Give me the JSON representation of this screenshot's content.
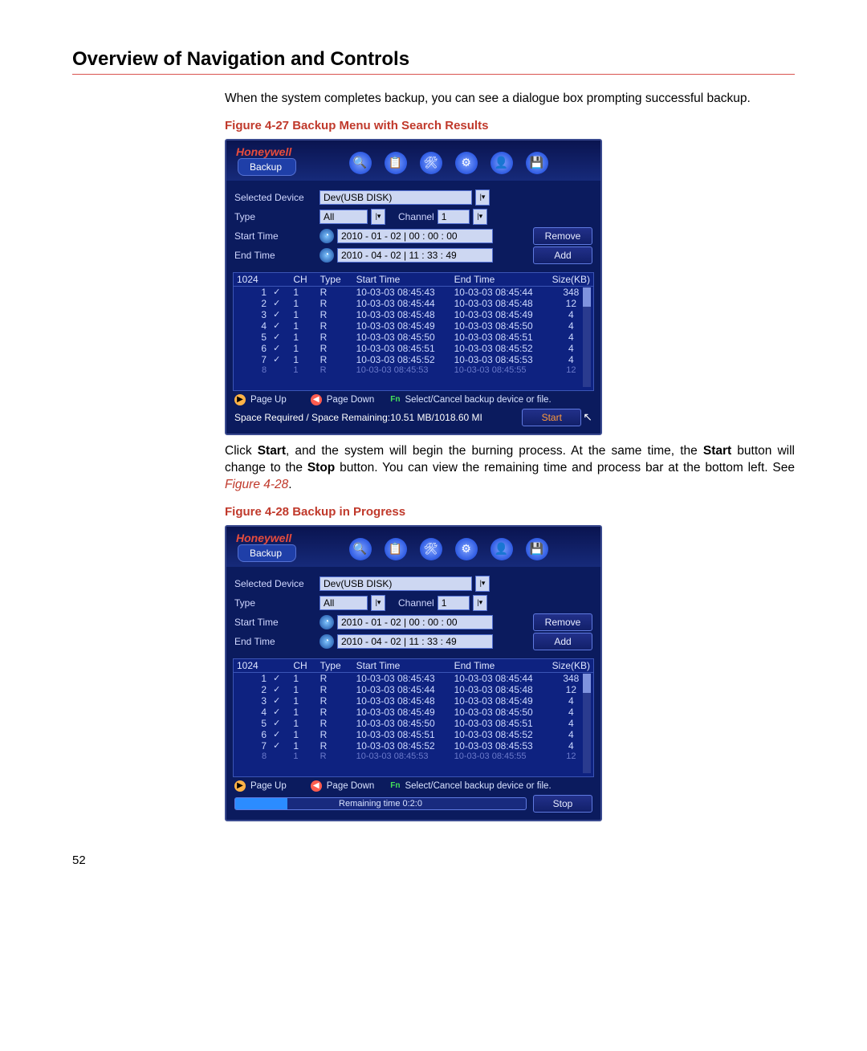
{
  "page": {
    "title": "Overview of Navigation and Controls",
    "intro": "When the system completes backup, you can see a dialogue box prompting successful backup.",
    "fig1_caption": "Figure 4-27 Backup Menu with Search Results",
    "mid_text_1": "Click ",
    "mid_text_start": "Start",
    "mid_text_2": ", and the system will begin the burning process. At the same time, the ",
    "mid_text_start2": "Start",
    "mid_text_3": " button will change to the ",
    "mid_text_stop": "Stop",
    "mid_text_4": " button. You can view the remaining time and process bar at the bottom left. See ",
    "mid_text_ref": "Figure 4-28",
    "mid_text_5": ".",
    "fig2_caption": "Figure 4-28 Backup in Progress",
    "page_number": "52"
  },
  "dvr": {
    "brand": "Honeywell",
    "tab": "Backup",
    "labels": {
      "selected_device": "Selected Device",
      "type": "Type",
      "channel": "Channel",
      "start_time": "Start Time",
      "end_time": "End Time"
    },
    "fields": {
      "device": "Dev(USB DISK)",
      "type": "All",
      "channel": "1",
      "start_time": "2010  - 01 - 02  | 00 : 00 : 00",
      "end_time": "2010  - 04 - 02  | 11 : 33 : 49"
    },
    "buttons": {
      "remove": "Remove",
      "add": "Add",
      "start": "Start",
      "stop": "Stop"
    },
    "table": {
      "count": "1024",
      "headers": {
        "ch": "CH",
        "type": "Type",
        "start": "Start Time",
        "end": "End Time",
        "size": "Size(KB)"
      },
      "rows": [
        {
          "n": "1",
          "ch": "1",
          "t": "R",
          "s": "10-03-03 08:45:43",
          "e": "10-03-03 08:45:44",
          "sz": "348"
        },
        {
          "n": "2",
          "ch": "1",
          "t": "R",
          "s": "10-03-03 08:45:44",
          "e": "10-03-03 08:45:48",
          "sz": "12"
        },
        {
          "n": "3",
          "ch": "1",
          "t": "R",
          "s": "10-03-03 08:45:48",
          "e": "10-03-03 08:45:49",
          "sz": "4"
        },
        {
          "n": "4",
          "ch": "1",
          "t": "R",
          "s": "10-03-03 08:45:49",
          "e": "10-03-03 08:45:50",
          "sz": "4"
        },
        {
          "n": "5",
          "ch": "1",
          "t": "R",
          "s": "10-03-03 08:45:50",
          "e": "10-03-03 08:45:51",
          "sz": "4"
        },
        {
          "n": "6",
          "ch": "1",
          "t": "R",
          "s": "10-03-03 08:45:51",
          "e": "10-03-03 08:45:52",
          "sz": "4"
        },
        {
          "n": "7",
          "ch": "1",
          "t": "R",
          "s": "10-03-03 08:45:52",
          "e": "10-03-03 08:45:53",
          "sz": "4"
        }
      ],
      "cut_row": {
        "n": "8",
        "ch": "1",
        "t": "R",
        "s": "10-03-03 08:45:53",
        "e": "10-03-03 08:45:55",
        "sz": "12"
      }
    },
    "pager": {
      "page_up": "Page Up",
      "page_down": "Page Down",
      "fn": "Fn",
      "hint": "Select/Cancel backup device or file."
    },
    "bottom1": "Space Required / Space Remaining:10.51 MB/1018.60 MI",
    "bottom2_remaining": "Remaining time 0:2:0",
    "progress_fill_pct": "18%",
    "top_icons": [
      "search-icon",
      "clipboard-icon",
      "tools-icon",
      "settings-icon",
      "user-icon",
      "disk-icon"
    ]
  }
}
